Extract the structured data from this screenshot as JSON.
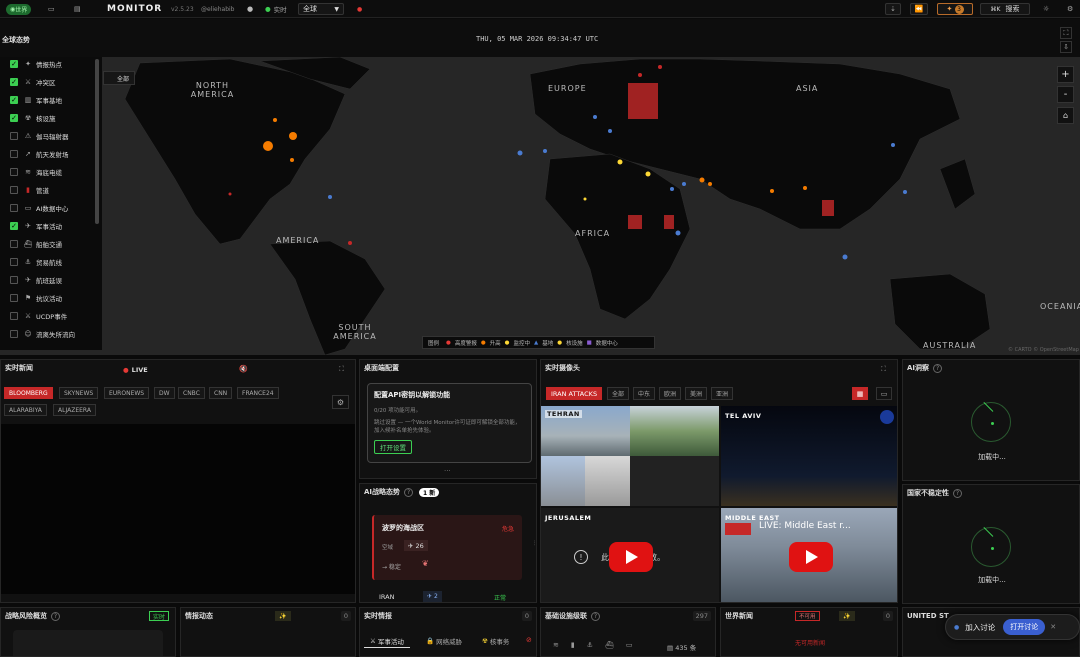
{
  "topbar": {
    "badge": "世界",
    "title": "MONITOR",
    "version": "v2.5.23",
    "handle": "@eliehabib",
    "live": "实时",
    "region": "全球",
    "badge_count": "3",
    "shortcut": "⌘K",
    "search": "搜索"
  },
  "map": {
    "title": "全球态势",
    "datetime": "THU, 05 MAR 2026 09:34:47 UTC",
    "all_btn": "全部",
    "attribution": "© CARTO © OpenStreetMap",
    "labels": [
      "NORTH AMERICA",
      "EUROPE",
      "ASIA",
      "AFRICA",
      "AMERICA",
      "SOUTH AMERICA",
      "AUSTRALIA",
      "OCEANIA"
    ],
    "legend_title": "图例",
    "legend": [
      "高度警报",
      "升高",
      "监控中",
      "基地",
      "核设施",
      "数据中心"
    ]
  },
  "layers": [
    {
      "label": "情报热点",
      "on": true
    },
    {
      "label": "冲突区",
      "on": true
    },
    {
      "label": "军事基地",
      "on": true
    },
    {
      "label": "核设施",
      "on": true
    },
    {
      "label": "伽马辐射器",
      "on": false
    },
    {
      "label": "航天发射场",
      "on": false
    },
    {
      "label": "海底电缆",
      "on": false
    },
    {
      "label": "管道",
      "on": false
    },
    {
      "label": "AI数据中心",
      "on": false
    },
    {
      "label": "军事活动",
      "on": true
    },
    {
      "label": "船舶交通",
      "on": false
    },
    {
      "label": "贸易航线",
      "on": false
    },
    {
      "label": "航班延误",
      "on": false
    },
    {
      "label": "抗议活动",
      "on": false
    },
    {
      "label": "UCDP事件",
      "on": false
    },
    {
      "label": "流离失所流向",
      "on": false
    }
  ],
  "news": {
    "title": "实时新闻",
    "live": "LIVE",
    "channels": [
      "BLOOMBERG",
      "SKYNEWS",
      "EURONEWS",
      "DW",
      "CNBC",
      "CNN",
      "FRANCE24",
      "ALARABIYA",
      "ALJAZEERA"
    ]
  },
  "desktop": {
    "title": "桌面端配置",
    "card_title": "配置API密钥以解锁功能",
    "card_sub": "0/20 项功能可用。",
    "card_text": "跳过设置 — 一个World Monitor许可证即可解锁全部功能，加入候补名单抢先体验。",
    "btn": "打开设置"
  },
  "ai_strategy": {
    "title": "AI战略态势",
    "badge": "1 新",
    "card_title": "波罗的海战区",
    "level": "危急",
    "label": "空域",
    "value": "26",
    "trend": "→ 稳定",
    "row2": "IRAN",
    "row2_val": "2",
    "row2_status": "正常"
  },
  "cams": {
    "title": "实时摄像头",
    "tabs": [
      "IRAN ATTACKS",
      "全部",
      "中东",
      "欧洲",
      "美洲",
      "亚洲"
    ],
    "cam1": "TEHRAN",
    "cam2": "TEL AVIV",
    "cam3": "JERUSALEM",
    "cam3_msg": "此视频无法播放。",
    "cam4": "MIDDLE EAST",
    "cam4_title": "LIVE: Middle East r..."
  },
  "insight": {
    "title": "AI洞察",
    "loading": "加载中...",
    "title2": "国家不稳定性",
    "loading2": "加载中..."
  },
  "bottom": {
    "p1": "战略风险概览",
    "p1_badge": "实时",
    "p2": "情报动态",
    "p2_count": "0",
    "p3": "实时情报",
    "p3_count": "0",
    "p3_tabs": [
      "军事活动",
      "网络威胁",
      "核事务"
    ],
    "p4": "基础设施级联",
    "p4_count": "297",
    "p4_stats": "435 条",
    "p5": "世界新闻",
    "p5_badge": "不可用",
    "p5_count": "0",
    "p5_msg": "无可用新闻",
    "p6": "UNITED ST",
    "discuss": "加入讨论",
    "open_discuss": "打开讨论"
  }
}
